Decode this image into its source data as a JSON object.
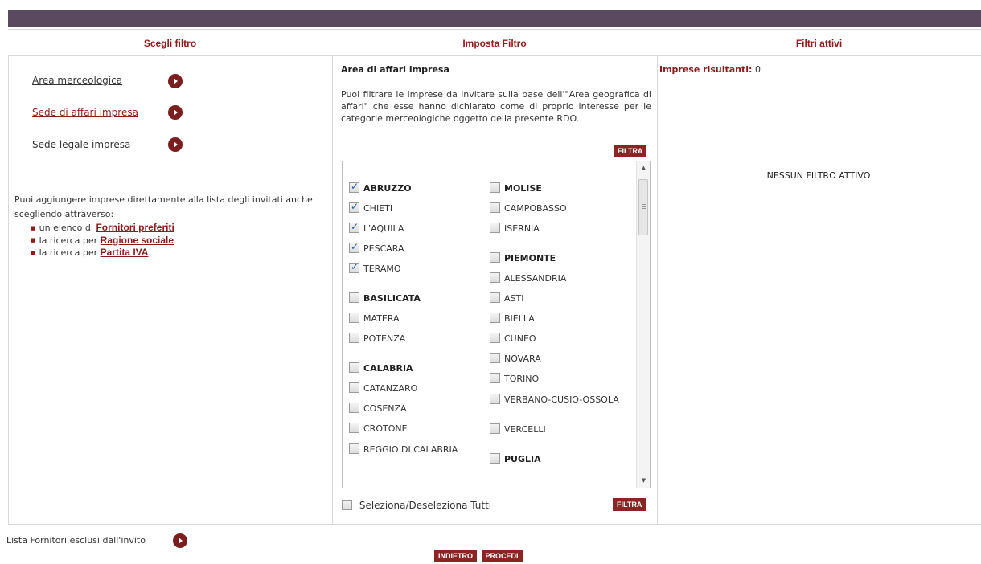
{
  "header": {
    "col1": "Scegli filtro",
    "col2": "Imposta Filtro",
    "col3": "Filtri attivi"
  },
  "left": {
    "nav": [
      {
        "label": "Area merceologica",
        "active": false
      },
      {
        "label": "Sede di affari impresa",
        "active": true
      },
      {
        "label": "Sede legale impresa",
        "active": false
      }
    ],
    "add_text": "Puoi aggiungere imprese direttamente alla lista degli invitati anche scegliendo attraverso:",
    "add_items": [
      {
        "prefix": "un elenco di",
        "link": "Fornitori preferiti"
      },
      {
        "prefix": "la ricerca per",
        "link": "Ragione sociale"
      },
      {
        "prefix": "la ricerca per",
        "link": "Partita IVA"
      }
    ]
  },
  "middle": {
    "title": "Area di affari impresa",
    "description": "Puoi filtrare le imprese da invitare sulla base dell'\"Area geografica di affari\" che esse hanno dichiarato come di proprio interesse per le categorie merceologiche oggetto della presente RDO.",
    "filter_button": "FILTRA",
    "select_all_label": "Seleziona/Deseleziona Tutti",
    "regions_left": [
      {
        "label": "ABRUZZO",
        "region": true,
        "checked": true
      },
      {
        "label": "CHIETI",
        "checked": true
      },
      {
        "label": "L'AQUILA",
        "checked": true
      },
      {
        "label": "PESCARA",
        "checked": true
      },
      {
        "label": "TERAMO",
        "checked": true
      },
      {
        "label": "BASILICATA",
        "region": true,
        "checked": false
      },
      {
        "label": "MATERA",
        "checked": false
      },
      {
        "label": "POTENZA",
        "checked": false
      },
      {
        "label": "CALABRIA",
        "region": true,
        "checked": false
      },
      {
        "label": "CATANZARO",
        "checked": false
      },
      {
        "label": "COSENZA",
        "checked": false
      },
      {
        "label": "CROTONE",
        "checked": false
      },
      {
        "label": "REGGIO DI CALABRIA",
        "checked": false
      }
    ],
    "regions_right": [
      {
        "label": "MOLISE",
        "region": true,
        "checked": false
      },
      {
        "label": "CAMPOBASSO",
        "checked": false
      },
      {
        "label": "ISERNIA",
        "checked": false
      },
      {
        "label": "PIEMONTE",
        "region": true,
        "checked": false
      },
      {
        "label": "ALESSANDRIA",
        "checked": false
      },
      {
        "label": "ASTI",
        "checked": false
      },
      {
        "label": "BIELLA",
        "checked": false
      },
      {
        "label": "CUNEO",
        "checked": false
      },
      {
        "label": "NOVARA",
        "checked": false
      },
      {
        "label": "TORINO",
        "checked": false
      },
      {
        "label": "VERBANO-CUSIO-OSSOLA",
        "checked": false
      },
      {
        "label": "VERCELLI",
        "checked": false
      },
      {
        "label": "PUGLIA",
        "region": true,
        "checked": false
      }
    ]
  },
  "right": {
    "count_label": "Imprese risultanti:",
    "count_value": "0",
    "no_filter": "NESSUN FILTRO ATTIVO"
  },
  "footer": {
    "excluded_label": "Lista Fornitori esclusi dall'invito",
    "back_button": "INDIETRO",
    "next_button": "PROCEDI"
  },
  "colors": {
    "accent": "#8c1d1d",
    "top_bar": "#5b4a5f"
  }
}
